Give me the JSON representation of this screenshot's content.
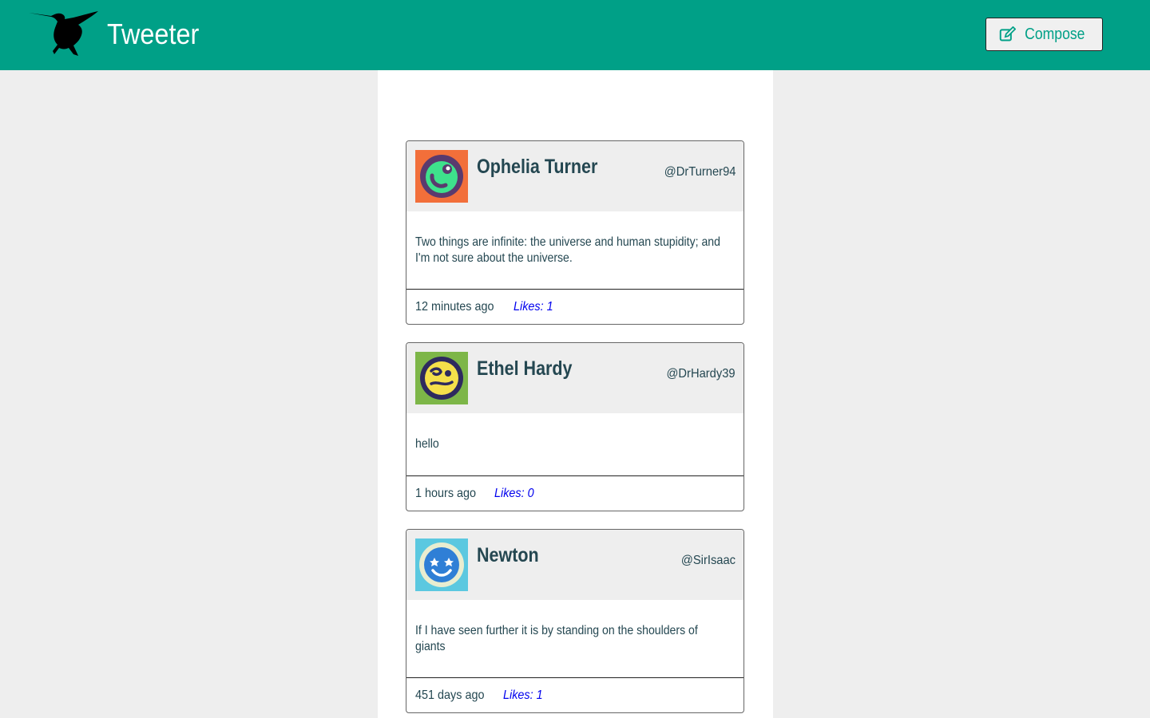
{
  "app": {
    "title": "Tweeter",
    "logo_icon": "hummingbird-icon",
    "brand_color": "#00a087"
  },
  "header": {
    "compose_label": "Compose",
    "compose_icon": "edit-icon"
  },
  "tweets": [
    {
      "name": "Ophelia Turner",
      "handle": "@DrTurner94",
      "text": "Two things are infinite: the universe and human stupidity; and I'm not sure about the universe.",
      "time": "12 minutes ago",
      "likes": "Likes: 1",
      "avatar_icon": "avatar-face-icon",
      "avatar_bg": "#f26f3a"
    },
    {
      "name": "Ethel Hardy",
      "handle": "@DrHardy39",
      "text": "hello",
      "time": "1 hours ago",
      "likes": "Likes: 0",
      "avatar_icon": "avatar-face-icon",
      "avatar_bg": "#7db648"
    },
    {
      "name": "Newton",
      "handle": "@SirIsaac",
      "text": "If I have seen further it is by standing on the shoulders of giants",
      "time": "451 days ago",
      "likes": "Likes: 1",
      "avatar_icon": "avatar-face-icon",
      "avatar_bg": "#5bc8e0"
    }
  ]
}
